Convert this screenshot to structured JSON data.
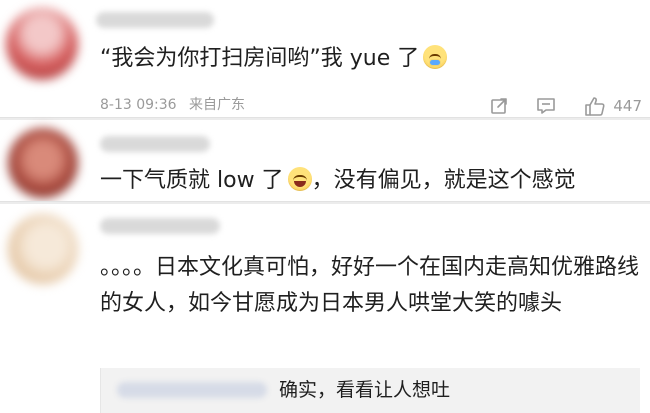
{
  "comments": [
    {
      "text": "“我会为你打扫房间哟”我 yue 了",
      "emoji": "crying-sweat-emoji",
      "date": "8-13 09:36",
      "location": "来自广东",
      "like_count": "447"
    },
    {
      "text_before": "一下气质就 low 了",
      "emoji": "laughing-tears-emoji",
      "text_after": "，没有偏见，就是这个感觉"
    },
    {
      "text": "。。。。日本文化真可怕，好好一个在国内走高知优雅路线的女人，如今甘愿成为日本男人哄堂大笑的噱头",
      "reply": {
        "text": "确实，看看让人想吐"
      }
    }
  ],
  "colors": {
    "text": "#1f1f1f",
    "meta": "#9a9a9a",
    "divider": "#ececec",
    "reply_bg": "#f2f2f2"
  }
}
